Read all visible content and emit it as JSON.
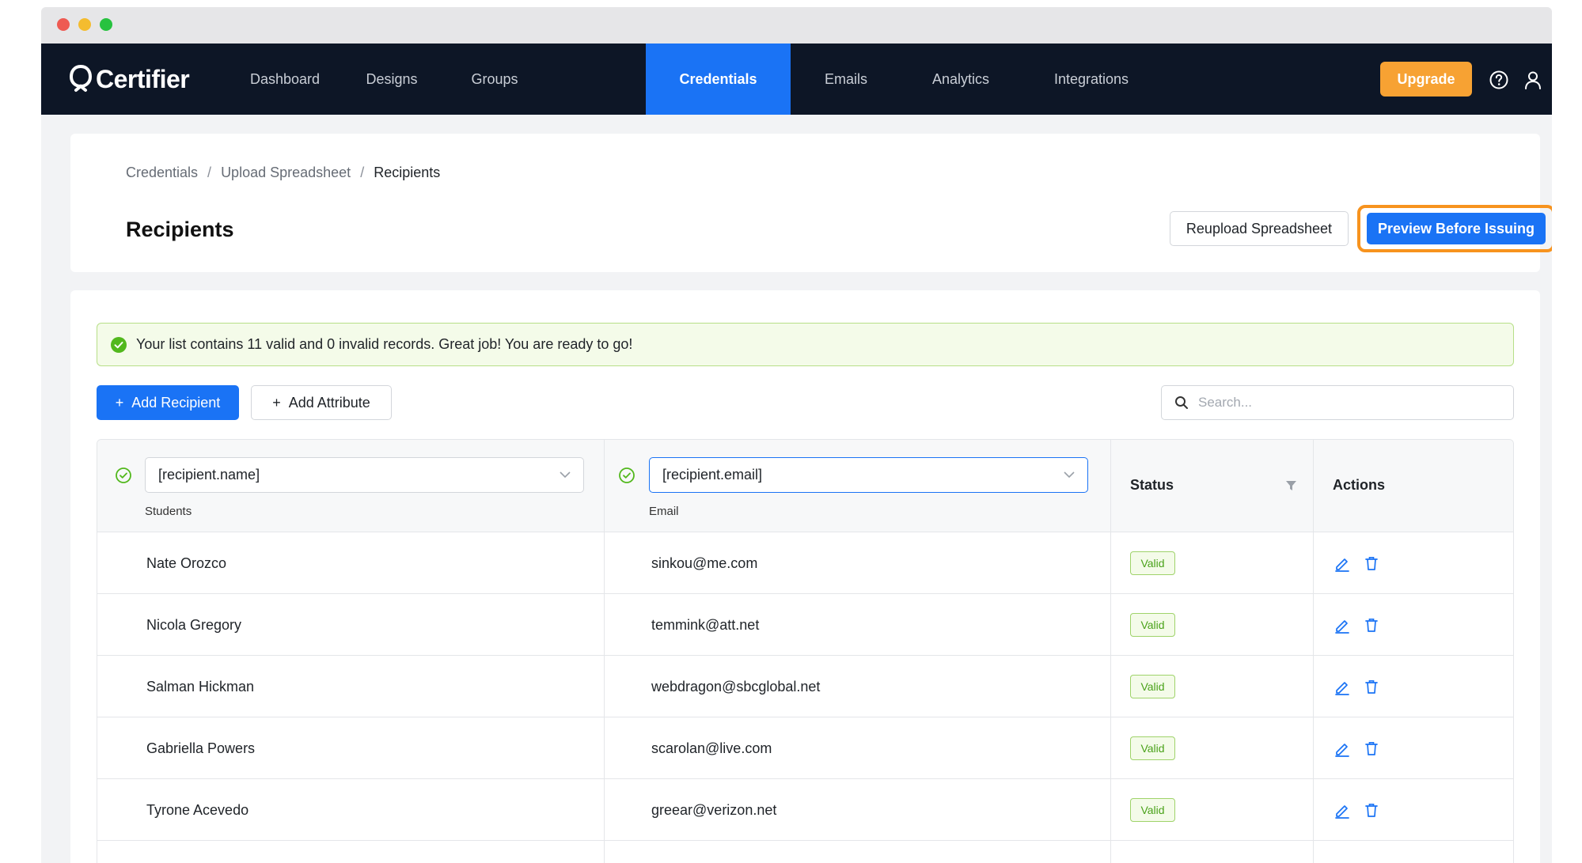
{
  "brand": {
    "name": "Certifier"
  },
  "nav": {
    "items": [
      {
        "label": "Dashboard",
        "active": false
      },
      {
        "label": "Designs",
        "active": false
      },
      {
        "label": "Groups",
        "active": false
      },
      {
        "label": "Credentials",
        "active": true
      },
      {
        "label": "Emails",
        "active": false
      },
      {
        "label": "Analytics",
        "active": false
      },
      {
        "label": "Integrations",
        "active": false
      }
    ],
    "upgrade_label": "Upgrade",
    "help_icon": "help-icon",
    "user_icon": "user-icon"
  },
  "breadcrumb": {
    "items": [
      "Credentials",
      "Upload Spreadsheet",
      "Recipients"
    ],
    "separator": "/"
  },
  "page": {
    "title": "Recipients",
    "reupload_label": "Reupload Spreadsheet",
    "preview_label": "Preview Before Issuing"
  },
  "alert": {
    "text": "Your list contains 11 valid and 0 invalid records. Great job! You are ready to go!"
  },
  "toolbar": {
    "add_recipient_label": "Add Recipient",
    "add_attribute_label": "Add Attribute",
    "search_placeholder": "Search..."
  },
  "table": {
    "columns": {
      "name": {
        "selected": "[recipient.name]",
        "label": "Students"
      },
      "email": {
        "selected": "[recipient.email]",
        "label": "Email"
      },
      "status": "Status",
      "actions": "Actions"
    },
    "rows": [
      {
        "name": "Nate Orozco",
        "email": "sinkou@me.com",
        "status": "Valid"
      },
      {
        "name": "Nicola Gregory",
        "email": "temmink@att.net",
        "status": "Valid"
      },
      {
        "name": "Salman Hickman",
        "email": "webdragon@sbcglobal.net",
        "status": "Valid"
      },
      {
        "name": "Gabriella Powers",
        "email": "scarolan@live.com",
        "status": "Valid"
      },
      {
        "name": "Tyrone Acevedo",
        "email": "greear@verizon.net",
        "status": "Valid"
      }
    ]
  },
  "colors": {
    "nav_bg": "#0d1626",
    "accent": "#1a73f5",
    "upgrade": "#f7a233",
    "highlight": "#f7931e",
    "valid_green": "#4aa21a"
  }
}
